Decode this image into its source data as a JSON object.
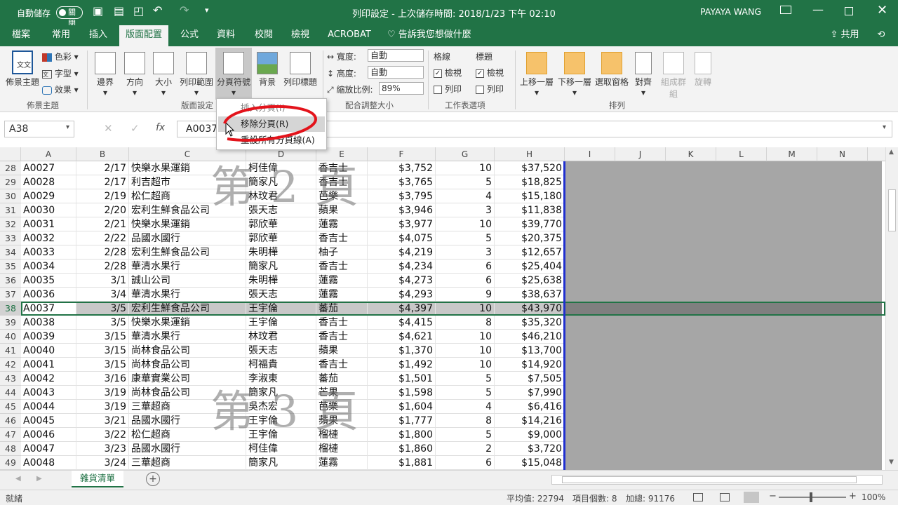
{
  "titlebar": {
    "autosave_label": "自動儲存",
    "autosave_state": "關閉",
    "title": "列印設定 - 上次儲存時間: 2018/1/23 下午 02:10",
    "user": "PAYAYA WANG"
  },
  "tabs": [
    "檔案",
    "常用",
    "插入",
    "版面配置",
    "公式",
    "資料",
    "校閱",
    "檢視",
    "ACROBAT"
  ],
  "tellme": "告訴我您想做什麼",
  "share": "共用",
  "ribbon": {
    "theme_label": "佈景主題",
    "colors": "色彩",
    "fonts": "字型",
    "effects": "效果",
    "theme_group": "佈景主題",
    "margins": "邊界",
    "orientation": "方向",
    "size": "大小",
    "print_area": "列印範圍",
    "breaks": "分頁符號",
    "background": "背景",
    "print_titles": "列印標題",
    "page_setup_group": "版面設定",
    "width_label": "寬度:",
    "width_val": "自動",
    "height_label": "高度:",
    "height_val": "自動",
    "scale_label": "縮放比例:",
    "scale_val": "89%",
    "scale_group": "配合調整大小",
    "gridlines": "格線",
    "headings": "標題",
    "view": "檢視",
    "print": "列印",
    "sheet_group": "工作表選項",
    "bring_forward": "上移一層",
    "send_backward": "下移一層",
    "selection_pane": "選取窗格",
    "align": "對齊",
    "group": "組成群組",
    "rotate": "旋轉",
    "arrange_group": "排列"
  },
  "menu": {
    "insert_break": "插入分頁(I)",
    "remove_break": "移除分頁(R)",
    "reset_breaks": "重設所有分頁線(A)"
  },
  "formula": {
    "namebox": "A38",
    "content": "A0037"
  },
  "columns": [
    "A",
    "B",
    "C",
    "D",
    "E",
    "F",
    "G",
    "H",
    "I",
    "J",
    "K",
    "L",
    "M",
    "N"
  ],
  "watermarks": [
    "第 2 頁",
    "第 3 頁"
  ],
  "rows": [
    {
      "n": "28",
      "a": "A0027",
      "b": "2/17",
      "c": "快樂水果運銷",
      "d": "柯佳偉",
      "e": "香吉士",
      "f": "$3,752",
      "g": "10",
      "h": "$37,520"
    },
    {
      "n": "29",
      "a": "A0028",
      "b": "2/17",
      "c": "利吉超市",
      "d": "簡家凡",
      "e": "香吉士",
      "f": "$3,765",
      "g": "5",
      "h": "$18,825"
    },
    {
      "n": "30",
      "a": "A0029",
      "b": "2/19",
      "c": "松仁超商",
      "d": "林玟君",
      "e": "芭樂",
      "f": "$3,795",
      "g": "4",
      "h": "$15,180"
    },
    {
      "n": "31",
      "a": "A0030",
      "b": "2/20",
      "c": "宏利生鮮食品公司",
      "d": "張天志",
      "e": "蘋果",
      "f": "$3,946",
      "g": "3",
      "h": "$11,838"
    },
    {
      "n": "32",
      "a": "A0031",
      "b": "2/21",
      "c": "快樂水果運銷",
      "d": "郭欣華",
      "e": "蓮霧",
      "f": "$3,977",
      "g": "10",
      "h": "$39,770"
    },
    {
      "n": "33",
      "a": "A0032",
      "b": "2/22",
      "c": "品國水國行",
      "d": "郭欣華",
      "e": "香吉士",
      "f": "$4,075",
      "g": "5",
      "h": "$20,375"
    },
    {
      "n": "34",
      "a": "A0033",
      "b": "2/28",
      "c": "宏利生鮮食品公司",
      "d": "朱明樺",
      "e": "柚子",
      "f": "$4,219",
      "g": "3",
      "h": "$12,657"
    },
    {
      "n": "35",
      "a": "A0034",
      "b": "2/28",
      "c": "華清水果行",
      "d": "簡家凡",
      "e": "香吉士",
      "f": "$4,234",
      "g": "6",
      "h": "$25,404"
    },
    {
      "n": "36",
      "a": "A0035",
      "b": "3/1",
      "c": "誠山公司",
      "d": "朱明樺",
      "e": "蓮霧",
      "f": "$4,273",
      "g": "6",
      "h": "$25,638"
    },
    {
      "n": "37",
      "a": "A0036",
      "b": "3/4",
      "c": "華清水果行",
      "d": "張天志",
      "e": "蓮霧",
      "f": "$4,293",
      "g": "9",
      "h": "$38,637"
    },
    {
      "n": "38",
      "a": "A0037",
      "b": "3/5",
      "c": "宏利生鮮食品公司",
      "d": "王宇倫",
      "e": "蕃茄",
      "f": "$4,397",
      "g": "10",
      "h": "$43,970"
    },
    {
      "n": "39",
      "a": "A0038",
      "b": "3/5",
      "c": "快樂水果運銷",
      "d": "王宇倫",
      "e": "香吉士",
      "f": "$4,415",
      "g": "8",
      "h": "$35,320"
    },
    {
      "n": "40",
      "a": "A0039",
      "b": "3/15",
      "c": "華清水果行",
      "d": "林玟君",
      "e": "香吉士",
      "f": "$4,621",
      "g": "10",
      "h": "$46,210"
    },
    {
      "n": "41",
      "a": "A0040",
      "b": "3/15",
      "c": "尚林食品公司",
      "d": "張天志",
      "e": "蘋果",
      "f": "$1,370",
      "g": "10",
      "h": "$13,700"
    },
    {
      "n": "42",
      "a": "A0041",
      "b": "3/15",
      "c": "尚林食品公司",
      "d": "柯福貴",
      "e": "香吉士",
      "f": "$1,492",
      "g": "10",
      "h": "$14,920"
    },
    {
      "n": "43",
      "a": "A0042",
      "b": "3/16",
      "c": "康華實業公司",
      "d": "李淑東",
      "e": "蕃茄",
      "f": "$1,501",
      "g": "5",
      "h": "$7,505"
    },
    {
      "n": "44",
      "a": "A0043",
      "b": "3/19",
      "c": "尚林食品公司",
      "d": "簡家凡",
      "e": "芒果",
      "f": "$1,598",
      "g": "5",
      "h": "$7,990"
    },
    {
      "n": "45",
      "a": "A0044",
      "b": "3/19",
      "c": "三華超商",
      "d": "吳杰宏",
      "e": "芭樂",
      "f": "$1,604",
      "g": "4",
      "h": "$6,416"
    },
    {
      "n": "46",
      "a": "A0045",
      "b": "3/21",
      "c": "品國水國行",
      "d": "王宇倫",
      "e": "蘋果",
      "f": "$1,777",
      "g": "8",
      "h": "$14,216"
    },
    {
      "n": "47",
      "a": "A0046",
      "b": "3/22",
      "c": "松仁超商",
      "d": "王宇倫",
      "e": "榴槤",
      "f": "$1,800",
      "g": "5",
      "h": "$9,000"
    },
    {
      "n": "48",
      "a": "A0047",
      "b": "3/23",
      "c": "品國水國行",
      "d": "柯佳偉",
      "e": "榴槤",
      "f": "$1,860",
      "g": "2",
      "h": "$3,720"
    },
    {
      "n": "49",
      "a": "A0048",
      "b": "3/24",
      "c": "三華超商",
      "d": "簡家凡",
      "e": "蓮霧",
      "f": "$1,881",
      "g": "6",
      "h": "$15,048"
    }
  ],
  "sheet_tab": "雜貨清單",
  "status": {
    "ready": "就緒",
    "average": "平均值: 22794",
    "count": "項目個數: 8",
    "sum": "加總: 91176",
    "zoom": "100%"
  }
}
